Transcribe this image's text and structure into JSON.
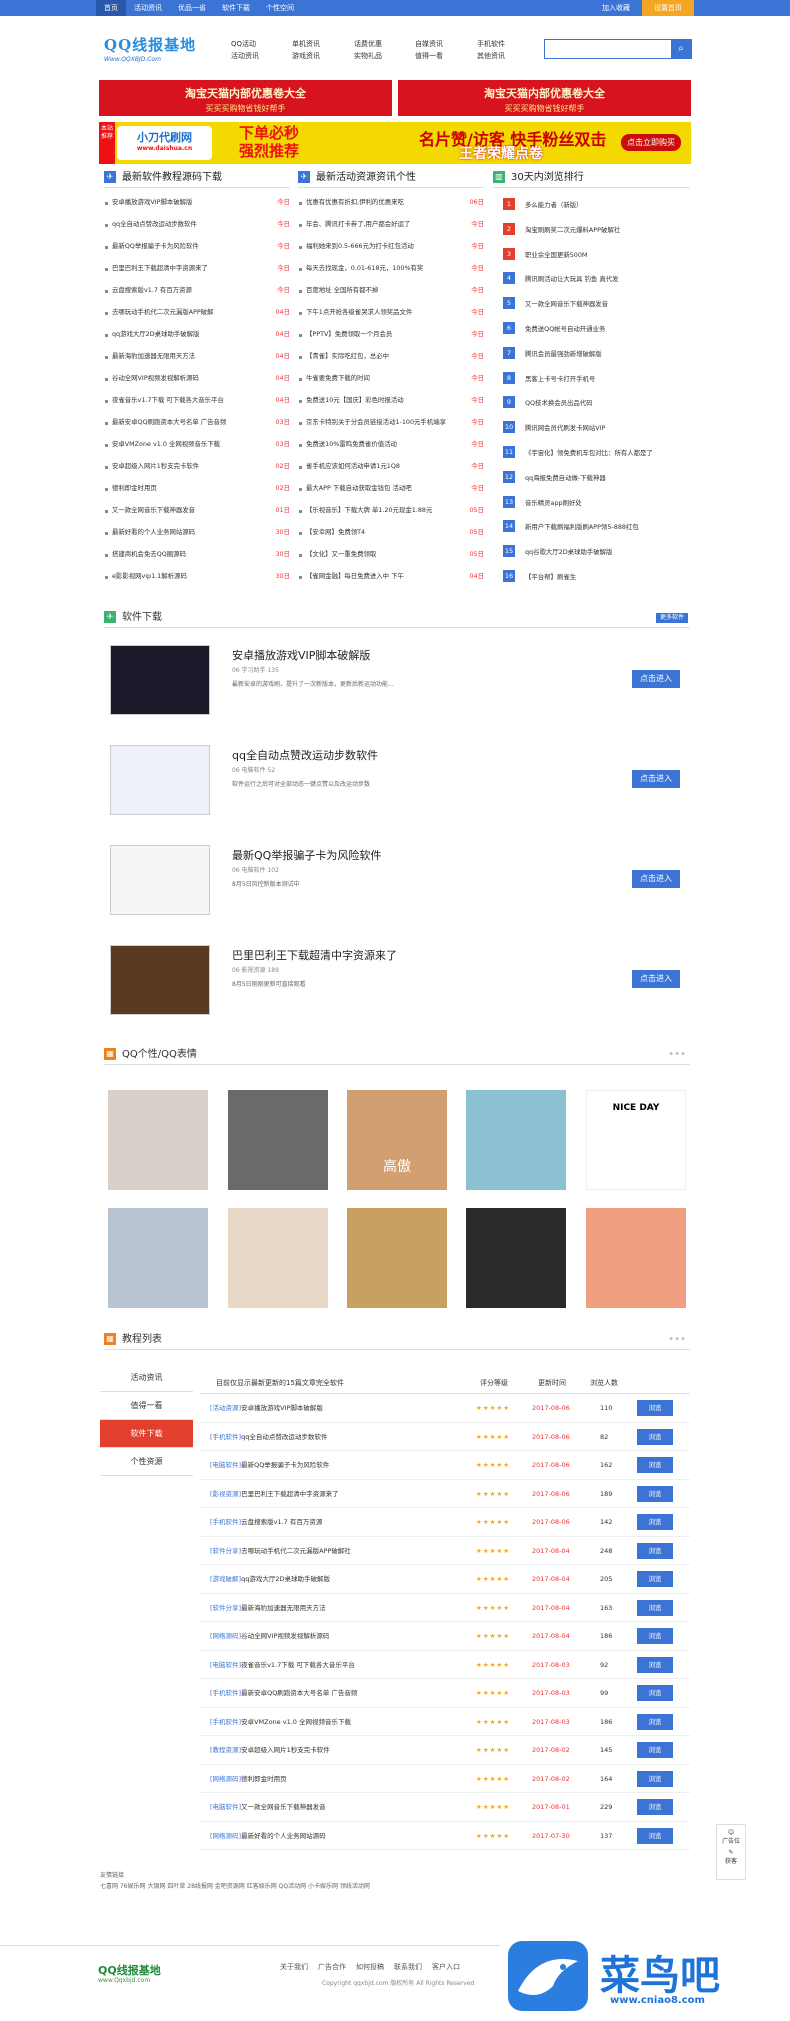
{
  "topnav": {
    "items": [
      "首页",
      "活动资讯",
      "优品一省",
      "软件下载",
      "个性空间"
    ],
    "right": [
      "加入收藏",
      "设置首页"
    ]
  },
  "logo": {
    "name": "QQ线报基地",
    "url": "Www.QQXBJD.Com"
  },
  "header_links": [
    [
      "QQ活动",
      "活动资讯"
    ],
    [
      "单机资讯",
      "游戏资讯"
    ],
    [
      "话费优惠",
      "实物礼品"
    ],
    [
      "自媒资讯",
      "值得一看"
    ],
    [
      "手机软件",
      "其他资讯"
    ]
  ],
  "banners": [
    {
      "t1": "淘宝天猫内部优惠卷大全",
      "t2": "买买买购物省钱好帮手"
    },
    {
      "t1": "淘宝天猫内部优惠卷大全",
      "t2": "买买买购物省钱好帮手"
    }
  ],
  "ad": {
    "tag": "本站推荐",
    "brand": "小刀代刷网",
    "url": "www.daishua.cn",
    "m1": "下单必秒",
    "m1b": "强烈推荐",
    "m2": "名片赞/访客 快手粉丝双击",
    "m3": "王者荣耀点卷",
    "btn": "点击立即购买"
  },
  "col1": {
    "title": "最新软件教程源码下载",
    "rows": [
      [
        "安卓播放游戏VIP脚本破解版",
        "今日"
      ],
      [
        "qq全自动点赞改运动步数软件",
        "今日"
      ],
      [
        "最新QQ举报骗子卡为风险软件",
        "今日"
      ],
      [
        "巴里巴利王下载超清中字资源来了",
        "今日"
      ],
      [
        "云盘搜索版v1.7 有百万资源",
        "今日"
      ],
      [
        "去哪玩动手机代二次元漏版APP破解",
        "04日"
      ],
      [
        "qq游戏大厅2D桌球助手破解版",
        "04日"
      ],
      [
        "最新海豹加速器无限用天方法",
        "04日"
      ],
      [
        "谷动全网VIP视频发视解析源码",
        "04日"
      ],
      [
        "夜雀音乐v1.7下载 可下载各大音乐平台",
        "04日"
      ],
      [
        "最新安卓QQ刷跑资本大号名单 广告音频",
        "03日"
      ],
      [
        "安卓VMZone v1.0 全网视频音乐下载",
        "03日"
      ],
      [
        "安卓超级入网片1秒支完卡软件",
        "02日"
      ],
      [
        "德利即金时用页",
        "02日"
      ],
      [
        "又一款全网音乐下载神器发音",
        "01日"
      ],
      [
        "最新好看的个人业务网站源码",
        "30日"
      ],
      [
        "搭建商机会免去QQ圈源码",
        "30日"
      ],
      [
        "e影影视网vip1.1解析源码",
        "30日"
      ]
    ]
  },
  "col2": {
    "title": "最新活动资源资讯个性",
    "rows": [
      [
        "优惠有优惠有折扣,伊利的优惠来吃",
        "06日"
      ],
      [
        "年会、腾讯打卡券了,用户都会好运了",
        "今日"
      ],
      [
        "福利她来到0.5-666元为打卡红包活动",
        "今日"
      ],
      [
        "每天去找现金，0.01-618元，100%有奖",
        "今日"
      ],
      [
        "百度地址 全国所有都不掉",
        "今日"
      ],
      [
        "下午1点开抢各级雀哭求人领奖品文件",
        "今日"
      ],
      [
        "【PPTV】免费领取一个月会员",
        "今日"
      ],
      [
        "【青雀】实际吃红包，总必中",
        "今日"
      ],
      [
        "牛雀要免费下载的时间",
        "今日"
      ],
      [
        "免费送10元【国庆】彩色时报活动",
        "今日"
      ],
      [
        "京东卡特别关于分会员链接活动1-100元手机端享",
        "今日"
      ],
      [
        "免费送10%雷鸣免费雀价值活动",
        "今日"
      ],
      [
        "雀手机应该如何活动申请1元1Q8",
        "今日"
      ],
      [
        "最大APP 下载自动获取金钱包 活动吧",
        "今日"
      ],
      [
        "【乐视音乐】下载大牌 单1.20元现金1.88元",
        "05日"
      ],
      [
        "【安幸网】免费领T4",
        "05日"
      ],
      [
        "【文化】又一重免费领取",
        "05日"
      ],
      [
        "【雀网金融】每日免费进入中 下午",
        "04日"
      ]
    ]
  },
  "col3": {
    "title": "30天内浏览排行",
    "rows": [
      "多么能力者（新版）",
      "淘宝刷刷奖二次元爆料APP破解社",
      "职业余全国更新500M",
      "腾讯刷活动让大玩具 钓鱼 真代发",
      "又一款全网音乐下载神器发音",
      "免费送QQ帐号自动开通业务",
      "腾讯会员最强劲新增破解版",
      "黑客上卡号卡打开手机号",
      "QQ技术换会员出品代码",
      "腾讯网会员代刷发卡网站VIP",
      "《宇宙化】领免费机车包对比：所有人都是了",
      "qq海报免费自动做-下载神器",
      "音乐精灵app刷好处",
      "新用户下载刷福利版刷APP领5-888红包",
      "qq谷歌大厅2D桌球助手破解版",
      "【平台帮】刷雀生"
    ]
  },
  "software": {
    "title": "软件下载",
    "more": "更多软件",
    "items": [
      {
        "title": "安卓播放游戏VIP脚本破解版",
        "meta": "06  学习助手  135",
        "desc": "最新安卓的游戏刷，提升了一次新版本，更新后新运动功能...",
        "go": "点击进入"
      },
      {
        "title": "qq全自动点赞改运动步数软件",
        "meta": "06  电脑软件  52",
        "desc": "软件运行之后可对全部动态一键点赞以及改运动步数",
        "go": "点击进入"
      },
      {
        "title": "最新QQ举报骗子卡为风险软件",
        "meta": "06  电脑软件  102",
        "desc": "8月5日风控新版本测试中",
        "go": "点击进入"
      },
      {
        "title": "巴里巴利王下载超清中字资源来了",
        "meta": "06  影视资源  189",
        "desc": "8月5日刚刚更新可直接观看",
        "go": "点击进入"
      }
    ]
  },
  "gallery": {
    "title": "QQ个性/QQ表情",
    "caption": "高傲",
    "nice": "NICE DAY"
  },
  "tutorial": {
    "title": "教程列表",
    "tabs": [
      "活动资讯",
      "值得一看",
      "软件下载",
      "个性资源"
    ],
    "active": 2,
    "headers": [
      "目前仅显示最新更新的15篇文章完全软件",
      "评分等级",
      "更新时间",
      "浏览人数"
    ],
    "stars": "★★★★★",
    "btn": "浏览",
    "rows": [
      [
        "[活动资源]",
        "安卓播放游戏VIP脚本破解版",
        "2017-08-06",
        "110"
      ],
      [
        "[手机软件]",
        "qq全自动点赞改运动步数软件",
        "2017-08-06",
        "82"
      ],
      [
        "[电脑软件]",
        "最新QQ举报骗子卡为风险软件",
        "2017-08-06",
        "162"
      ],
      [
        "[影视资源]",
        "巴里巴利王下载超清中字资源来了",
        "2017-08-06",
        "189"
      ],
      [
        "[手机软件]",
        "云盘搜索版v1.7 有百万资源",
        "2017-08-06",
        "142"
      ],
      [
        "[软件分享]",
        "去哪玩动手机代二次元漏版APP破解社",
        "2017-08-04",
        "248"
      ],
      [
        "[游戏破解]",
        "qq游戏大厅2D桌球助手破解版",
        "2017-08-04",
        "205"
      ],
      [
        "[软件分享]",
        "最新海豹加速器无限用天方法",
        "2017-08-04",
        "163"
      ],
      [
        "[网络源码]",
        "谷动全网VIP视频发视解析源码",
        "2017-08-04",
        "186"
      ],
      [
        "[电脑软件]",
        "夜雀音乐v1.7下载 可下载各大音乐平台",
        "2017-08-03",
        "92"
      ],
      [
        "[手机软件]",
        "最新安卓QQ刷跑资本大号名单 广告音频",
        "2017-08-03",
        "99"
      ],
      [
        "[手机软件]",
        "安卓VMZone v1.0 全网视频音乐下载",
        "2017-08-03",
        "186"
      ],
      [
        "[教程资源]",
        "安卓超级入网片1秒支完卡软件",
        "2017-08-02",
        "145"
      ],
      [
        "[网络源码]",
        "德利即金时用页",
        "2017-08-02",
        "164"
      ],
      [
        "[电脑软件]",
        "又一款全网音乐下载神器发音",
        "2017-08-01",
        "229"
      ],
      [
        "[网络源码]",
        "最新好看的个人业务网站源码",
        "2017-07-30",
        "137"
      ]
    ]
  },
  "friendlinks": {
    "title": "友情链接",
    "text": "七喜网 76娱乐网 大银网 四叶草 28线报网 金吧资源网 红客娱乐网 QQ活动网 小卡娱乐网 领线活动网"
  },
  "footer": {
    "logo": "QQ线报基地",
    "url": "www.Qqxbjd.com",
    "links": [
      "关于我们",
      "广告合作",
      "如何投稿",
      "联系我们",
      "客户入口"
    ],
    "copy": "Copyright qqxbjd.com 版权所有 All Rights Reserved"
  },
  "side": [
    "广告位",
    "获客"
  ],
  "watermark": {
    "text": "菜鸟吧",
    "url": "www.cniao8.com"
  }
}
